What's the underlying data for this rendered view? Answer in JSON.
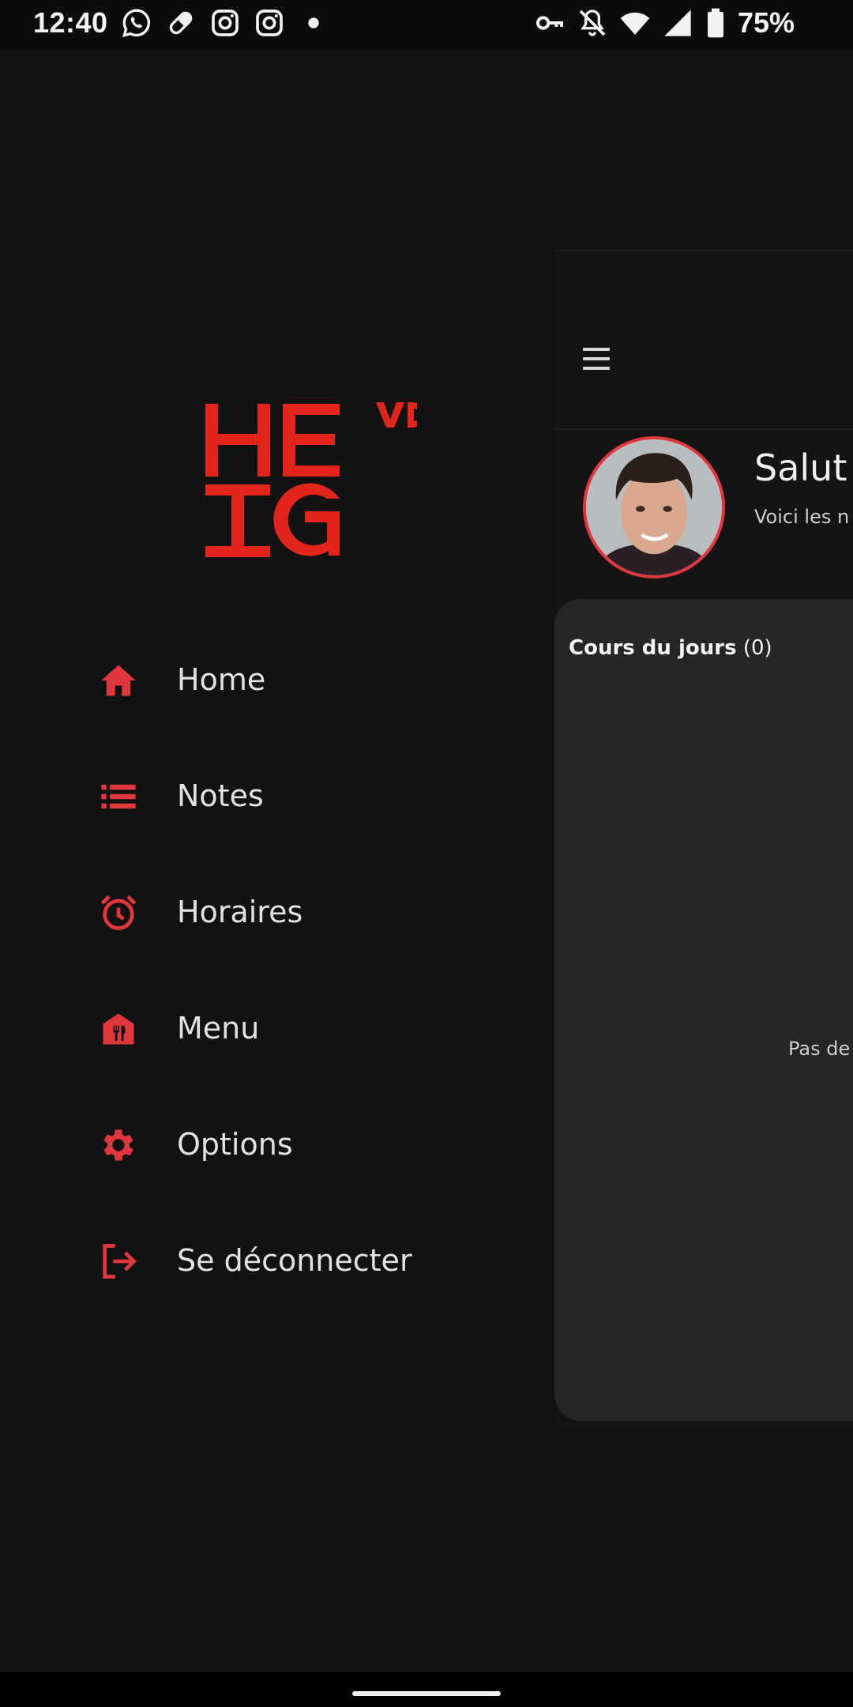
{
  "status_bar": {
    "time": "12:40",
    "battery": "75%",
    "notification_icons": [
      "whatsapp-icon",
      "pill-icon",
      "instagram-icon",
      "instagram-icon",
      "dot-icon"
    ],
    "system_icons": [
      "vpn-key-icon",
      "bell-off-icon",
      "wifi-icon",
      "signal-icon",
      "battery-icon"
    ]
  },
  "drawer": {
    "logo": {
      "line1": "HE",
      "line2": "IG",
      "sup": "VD"
    },
    "items": [
      {
        "label": "Home",
        "icon": "home-icon"
      },
      {
        "label": "Notes",
        "icon": "list-icon"
      },
      {
        "label": "Horaires",
        "icon": "alarm-clock-icon"
      },
      {
        "label": "Menu",
        "icon": "restaurant-icon"
      },
      {
        "label": "Options",
        "icon": "gear-icon"
      },
      {
        "label": "Se déconnecter",
        "icon": "logout-icon"
      }
    ]
  },
  "main": {
    "greeting": "Salut",
    "subgreeting": "Voici les n",
    "card": {
      "title": "Cours du jours",
      "count": "(0)",
      "empty_text": "Pas de"
    }
  },
  "colors": {
    "accent": "#e0373d",
    "background": "#121213",
    "card": "#262628"
  }
}
